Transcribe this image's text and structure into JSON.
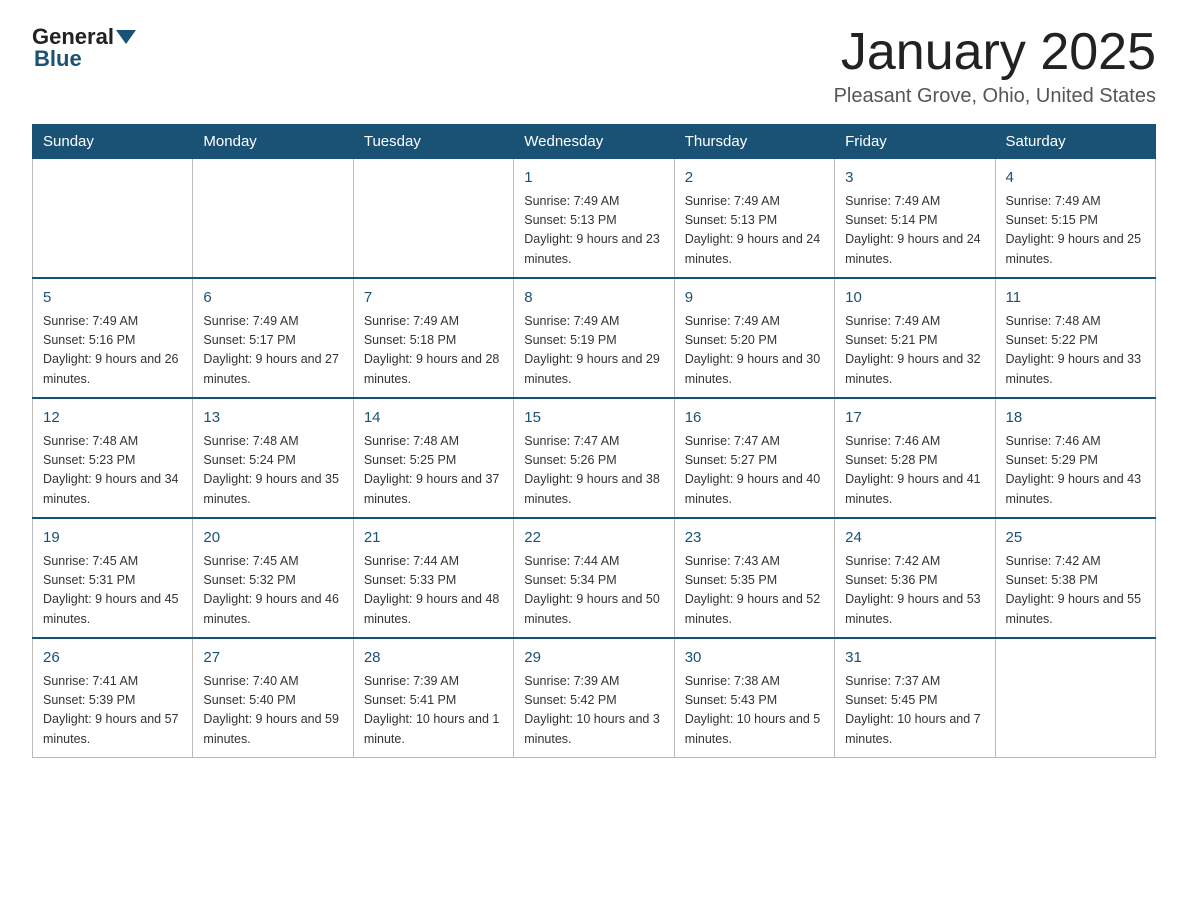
{
  "header": {
    "logo_general": "General",
    "logo_blue": "Blue",
    "month_title": "January 2025",
    "location": "Pleasant Grove, Ohio, United States"
  },
  "days_of_week": [
    "Sunday",
    "Monday",
    "Tuesday",
    "Wednesday",
    "Thursday",
    "Friday",
    "Saturday"
  ],
  "weeks": [
    [
      {
        "day": "",
        "info": ""
      },
      {
        "day": "",
        "info": ""
      },
      {
        "day": "",
        "info": ""
      },
      {
        "day": "1",
        "info": "Sunrise: 7:49 AM\nSunset: 5:13 PM\nDaylight: 9 hours\nand 23 minutes."
      },
      {
        "day": "2",
        "info": "Sunrise: 7:49 AM\nSunset: 5:13 PM\nDaylight: 9 hours\nand 24 minutes."
      },
      {
        "day": "3",
        "info": "Sunrise: 7:49 AM\nSunset: 5:14 PM\nDaylight: 9 hours\nand 24 minutes."
      },
      {
        "day": "4",
        "info": "Sunrise: 7:49 AM\nSunset: 5:15 PM\nDaylight: 9 hours\nand 25 minutes."
      }
    ],
    [
      {
        "day": "5",
        "info": "Sunrise: 7:49 AM\nSunset: 5:16 PM\nDaylight: 9 hours\nand 26 minutes."
      },
      {
        "day": "6",
        "info": "Sunrise: 7:49 AM\nSunset: 5:17 PM\nDaylight: 9 hours\nand 27 minutes."
      },
      {
        "day": "7",
        "info": "Sunrise: 7:49 AM\nSunset: 5:18 PM\nDaylight: 9 hours\nand 28 minutes."
      },
      {
        "day": "8",
        "info": "Sunrise: 7:49 AM\nSunset: 5:19 PM\nDaylight: 9 hours\nand 29 minutes."
      },
      {
        "day": "9",
        "info": "Sunrise: 7:49 AM\nSunset: 5:20 PM\nDaylight: 9 hours\nand 30 minutes."
      },
      {
        "day": "10",
        "info": "Sunrise: 7:49 AM\nSunset: 5:21 PM\nDaylight: 9 hours\nand 32 minutes."
      },
      {
        "day": "11",
        "info": "Sunrise: 7:48 AM\nSunset: 5:22 PM\nDaylight: 9 hours\nand 33 minutes."
      }
    ],
    [
      {
        "day": "12",
        "info": "Sunrise: 7:48 AM\nSunset: 5:23 PM\nDaylight: 9 hours\nand 34 minutes."
      },
      {
        "day": "13",
        "info": "Sunrise: 7:48 AM\nSunset: 5:24 PM\nDaylight: 9 hours\nand 35 minutes."
      },
      {
        "day": "14",
        "info": "Sunrise: 7:48 AM\nSunset: 5:25 PM\nDaylight: 9 hours\nand 37 minutes."
      },
      {
        "day": "15",
        "info": "Sunrise: 7:47 AM\nSunset: 5:26 PM\nDaylight: 9 hours\nand 38 minutes."
      },
      {
        "day": "16",
        "info": "Sunrise: 7:47 AM\nSunset: 5:27 PM\nDaylight: 9 hours\nand 40 minutes."
      },
      {
        "day": "17",
        "info": "Sunrise: 7:46 AM\nSunset: 5:28 PM\nDaylight: 9 hours\nand 41 minutes."
      },
      {
        "day": "18",
        "info": "Sunrise: 7:46 AM\nSunset: 5:29 PM\nDaylight: 9 hours\nand 43 minutes."
      }
    ],
    [
      {
        "day": "19",
        "info": "Sunrise: 7:45 AM\nSunset: 5:31 PM\nDaylight: 9 hours\nand 45 minutes."
      },
      {
        "day": "20",
        "info": "Sunrise: 7:45 AM\nSunset: 5:32 PM\nDaylight: 9 hours\nand 46 minutes."
      },
      {
        "day": "21",
        "info": "Sunrise: 7:44 AM\nSunset: 5:33 PM\nDaylight: 9 hours\nand 48 minutes."
      },
      {
        "day": "22",
        "info": "Sunrise: 7:44 AM\nSunset: 5:34 PM\nDaylight: 9 hours\nand 50 minutes."
      },
      {
        "day": "23",
        "info": "Sunrise: 7:43 AM\nSunset: 5:35 PM\nDaylight: 9 hours\nand 52 minutes."
      },
      {
        "day": "24",
        "info": "Sunrise: 7:42 AM\nSunset: 5:36 PM\nDaylight: 9 hours\nand 53 minutes."
      },
      {
        "day": "25",
        "info": "Sunrise: 7:42 AM\nSunset: 5:38 PM\nDaylight: 9 hours\nand 55 minutes."
      }
    ],
    [
      {
        "day": "26",
        "info": "Sunrise: 7:41 AM\nSunset: 5:39 PM\nDaylight: 9 hours\nand 57 minutes."
      },
      {
        "day": "27",
        "info": "Sunrise: 7:40 AM\nSunset: 5:40 PM\nDaylight: 9 hours\nand 59 minutes."
      },
      {
        "day": "28",
        "info": "Sunrise: 7:39 AM\nSunset: 5:41 PM\nDaylight: 10 hours\nand 1 minute."
      },
      {
        "day": "29",
        "info": "Sunrise: 7:39 AM\nSunset: 5:42 PM\nDaylight: 10 hours\nand 3 minutes."
      },
      {
        "day": "30",
        "info": "Sunrise: 7:38 AM\nSunset: 5:43 PM\nDaylight: 10 hours\nand 5 minutes."
      },
      {
        "day": "31",
        "info": "Sunrise: 7:37 AM\nSunset: 5:45 PM\nDaylight: 10 hours\nand 7 minutes."
      },
      {
        "day": "",
        "info": ""
      }
    ]
  ]
}
